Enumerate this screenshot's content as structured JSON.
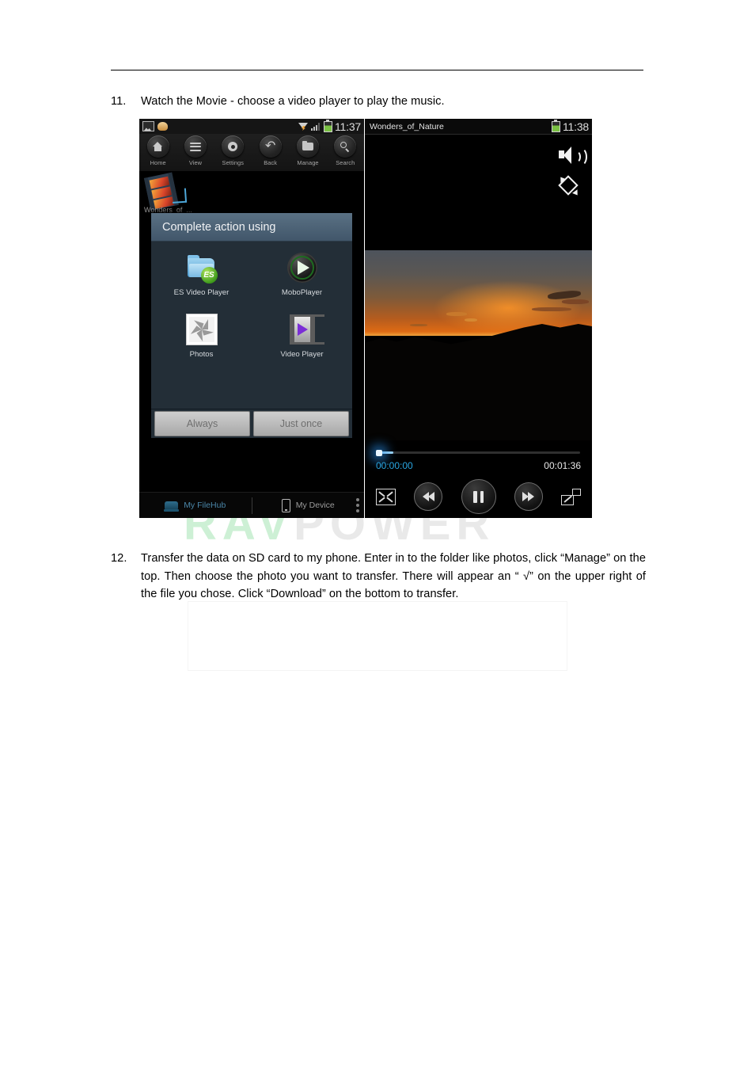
{
  "document": {
    "steps": [
      {
        "number": "11.",
        "text": "Watch the Movie - choose a video player to play the music."
      },
      {
        "number": "12.",
        "text": "Transfer the data on SD card to my phone. Enter in to the folder like photos, click “Manage” on the top. Then choose the photo you want to transfer. There will appear an “ √” on the upper right of the file you chose. Click “Download” on the bottom to transfer."
      }
    ],
    "watermark": {
      "part_a": "RAV",
      "part_b": "POWER",
      "color_a": "#cdf0d5",
      "color_b": "#e9e9e9"
    }
  },
  "left_screenshot": {
    "status_bar": {
      "clock": "11:37",
      "icons": [
        "gallery-icon",
        "download-icon",
        "wifi-icon",
        "signal-icon",
        "battery-icon"
      ]
    },
    "toolbar": [
      {
        "label": "Home",
        "icon": "home-icon"
      },
      {
        "label": "View",
        "icon": "list-icon"
      },
      {
        "label": "Settings",
        "icon": "gear-icon"
      },
      {
        "label": "Back",
        "icon": "back-arrow-icon"
      },
      {
        "label": "Manage",
        "icon": "folder-icon"
      },
      {
        "label": "Search",
        "icon": "search-icon"
      }
    ],
    "file_item": {
      "name": "Wonders_of_...",
      "icon": "film-strip-icon"
    },
    "dialog": {
      "title": "Complete action using",
      "apps": [
        {
          "label": "ES Video Player",
          "icon": "es-video-player-icon"
        },
        {
          "label": "MoboPlayer",
          "icon": "moboplayer-icon"
        },
        {
          "label": "Photos",
          "icon": "photos-icon"
        },
        {
          "label": "Video Player",
          "icon": "video-player-icon"
        }
      ],
      "buttons": [
        {
          "label": "Always"
        },
        {
          "label": "Just once"
        }
      ]
    },
    "bottom_tabs": [
      {
        "label": "My FileHub",
        "icon": "filehub-icon",
        "active": true
      },
      {
        "label": "My Device",
        "icon": "phone-icon",
        "active": false
      }
    ],
    "overflow_icon": "more-vertical-icon",
    "accent_color": "#4a86a8"
  },
  "right_screenshot": {
    "status_bar": {
      "title": "Wonders_of_Nature",
      "clock": "11:38",
      "icons": [
        "battery-icon"
      ]
    },
    "controls": {
      "volume_icon": "volume-icon",
      "rotate_icon": "screen-rotate-icon",
      "current_time": "00:00:00",
      "duration": "00:01:36",
      "progress_percent": 0,
      "buttons": [
        {
          "name": "fit-screen-button",
          "icon": "expand-icon"
        },
        {
          "name": "rewind-button",
          "icon": "rewind-icon"
        },
        {
          "name": "pause-button",
          "icon": "pause-icon"
        },
        {
          "name": "forward-button",
          "icon": "fast-forward-icon"
        },
        {
          "name": "popout-button",
          "icon": "popout-icon"
        }
      ]
    },
    "current_time_color": "#29a5e0",
    "video_description": "Sunset over mountain silhouettes"
  }
}
